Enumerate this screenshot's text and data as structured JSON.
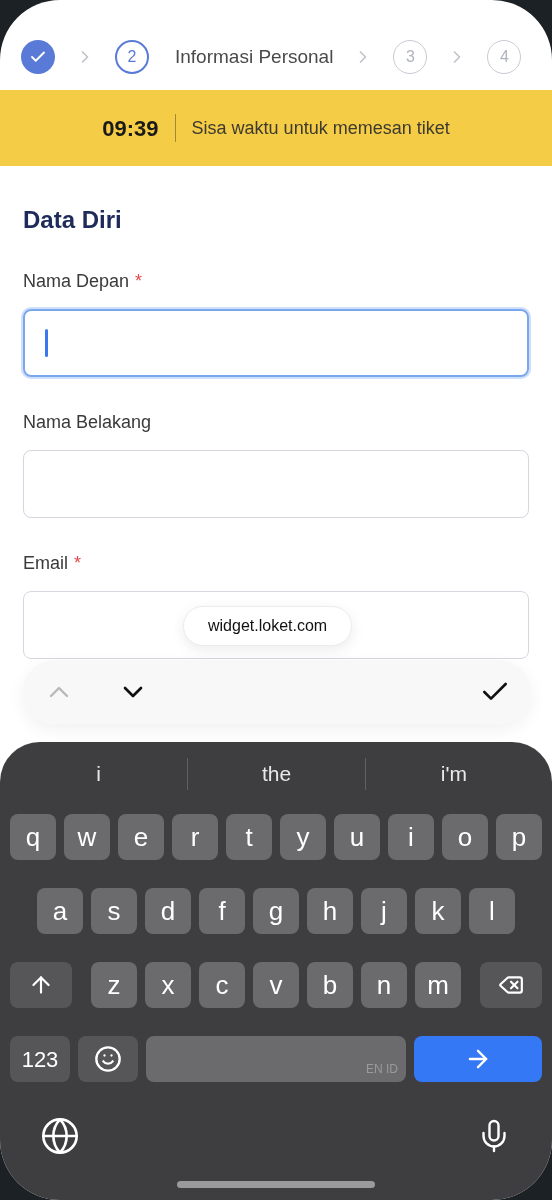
{
  "stepper": [
    {
      "kind": "done"
    },
    {
      "kind": "current",
      "label": "2",
      "title": "Informasi Personal"
    },
    {
      "kind": "pending",
      "label": "3"
    },
    {
      "kind": "pending",
      "label": "4"
    }
  ],
  "timer": {
    "time": "09:39",
    "text": "Sisa waktu untuk memesan tiket"
  },
  "section_title": "Data Diri",
  "fields": [
    {
      "label": "Nama Depan",
      "required": true,
      "focused": true
    },
    {
      "label": "Nama Belakang",
      "required": false,
      "focused": false
    },
    {
      "label": "Email",
      "required": true,
      "focused": false
    }
  ],
  "required_mark": "*",
  "url_pill": "widget.loket.com",
  "input_toolbar": {
    "previous_disabled": true,
    "next_disabled": false
  },
  "suggestions": [
    "i",
    "the",
    "i'm"
  ],
  "keyboard": {
    "rows": [
      [
        "q",
        "w",
        "e",
        "r",
        "t",
        "y",
        "u",
        "i",
        "o",
        "p"
      ],
      [
        "a",
        "s",
        "d",
        "f",
        "g",
        "h",
        "j",
        "k",
        "l"
      ],
      [
        "z",
        "x",
        "c",
        "v",
        "b",
        "n",
        "m"
      ]
    ],
    "numbers_key": "123",
    "space_languages": "EN ID"
  }
}
